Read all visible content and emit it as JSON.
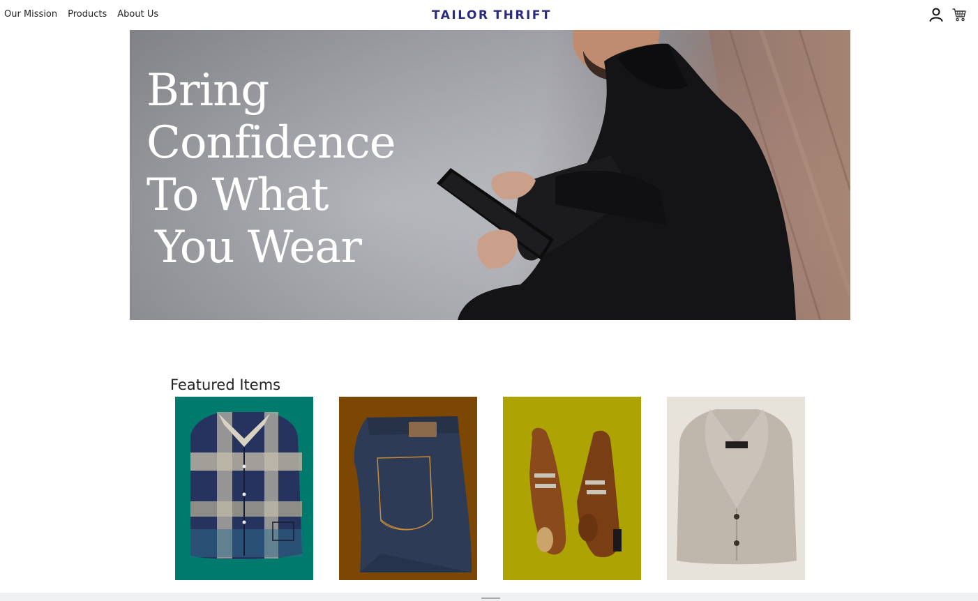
{
  "nav": {
    "links": [
      "Our Mission",
      "Products",
      "About Us"
    ],
    "logo": {
      "left": "TAILOR",
      "right": "THRIFT"
    },
    "icons": {
      "account": "user-icon",
      "cart": "cart-icon"
    }
  },
  "hero": {
    "headline_lines": [
      "Bring",
      "Confidence",
      "To What",
      "You Wear"
    ]
  },
  "featured": {
    "title": "Featured Items",
    "items": [
      {
        "name": "plaid button-down shirt",
        "background": "#007a6c"
      },
      {
        "name": "denim jeans",
        "background": "#7b4703"
      },
      {
        "name": "brown monk-strap shoes",
        "background": "#ada302"
      },
      {
        "name": "knit shawl-collar cardigan",
        "background": "#e8e3da"
      }
    ]
  },
  "colors": {
    "brand": "#2a2a80",
    "text": "#222222",
    "bottom_bar": "#eef0f2"
  }
}
